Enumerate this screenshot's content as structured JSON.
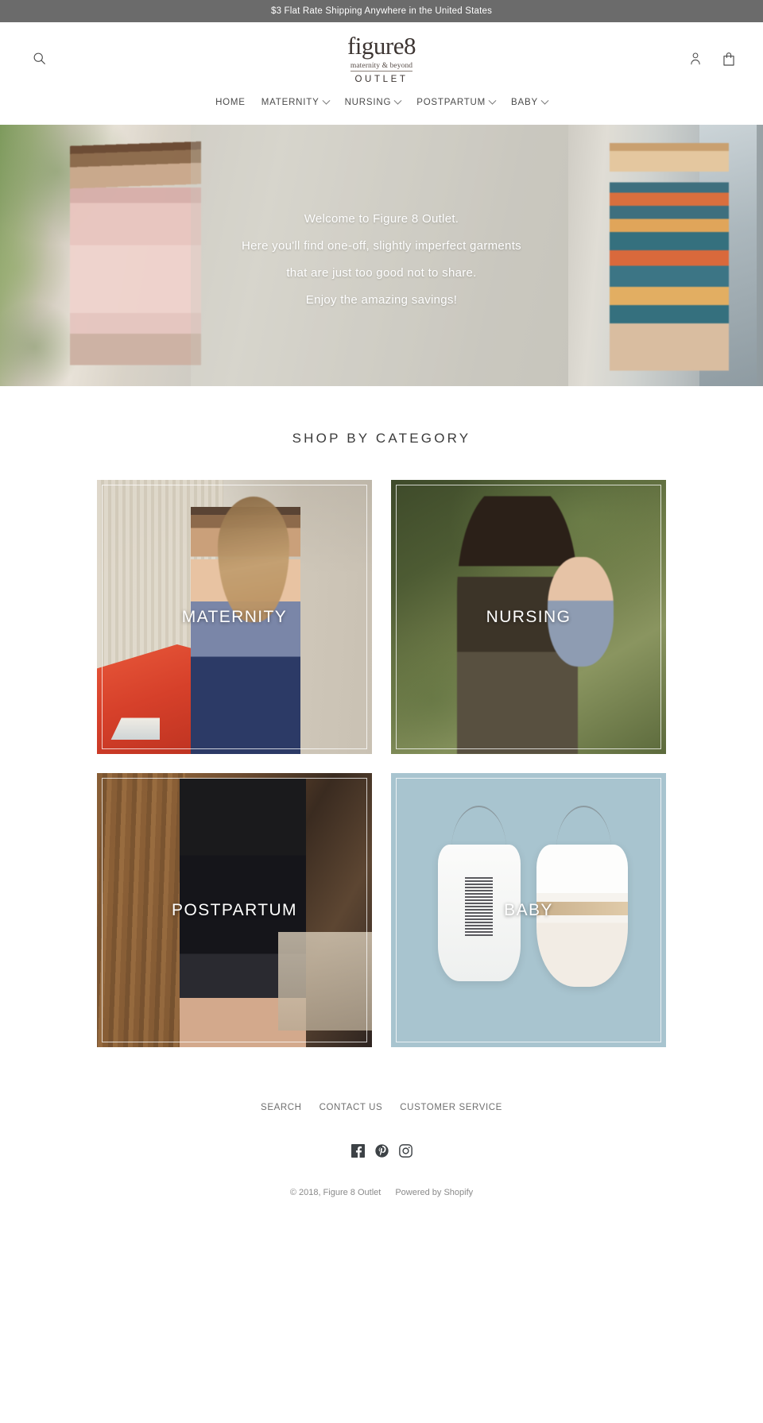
{
  "announcement": {
    "text": "$3 Flat Rate Shipping Anywhere in the United States"
  },
  "header": {
    "search_icon": "search-icon",
    "account_icon": "account-icon",
    "cart_icon": "cart-icon",
    "logo": {
      "main": "figure8",
      "sub": "maternity & beyond",
      "outlet": "OUTLET"
    }
  },
  "nav": {
    "items": [
      {
        "label": "HOME",
        "has_dropdown": false
      },
      {
        "label": "MATERNITY",
        "has_dropdown": true
      },
      {
        "label": "NURSING",
        "has_dropdown": true
      },
      {
        "label": "POSTPARTUM",
        "has_dropdown": true
      },
      {
        "label": "BABY",
        "has_dropdown": true
      }
    ]
  },
  "hero": {
    "lines": [
      "Welcome to Figure 8 Outlet.",
      "Here you'll find one-off, slightly imperfect garments",
      "that are just too good not to share.",
      "Enjoy the amazing savings!"
    ]
  },
  "categories": {
    "title": "SHOP BY CATEGORY",
    "tiles": [
      {
        "label": "MATERNITY"
      },
      {
        "label": "NURSING"
      },
      {
        "label": "POSTPARTUM"
      },
      {
        "label": "BABY"
      }
    ]
  },
  "footer": {
    "links": [
      {
        "label": "SEARCH"
      },
      {
        "label": "CONTACT US"
      },
      {
        "label": "CUSTOMER SERVICE"
      }
    ],
    "socials": [
      {
        "name": "facebook-icon"
      },
      {
        "name": "pinterest-icon"
      },
      {
        "name": "instagram-icon"
      }
    ],
    "copyright": "© 2018, Figure 8 Outlet",
    "powered_by": "Powered by Shopify"
  },
  "colors": {
    "announcement_bg": "#6b6b6b",
    "text_dark": "#3b3b3b",
    "text_muted": "#6f6f6f",
    "hero_overlay_text": "#ffffff",
    "baby_tile_bg": "#a8c4cf"
  }
}
